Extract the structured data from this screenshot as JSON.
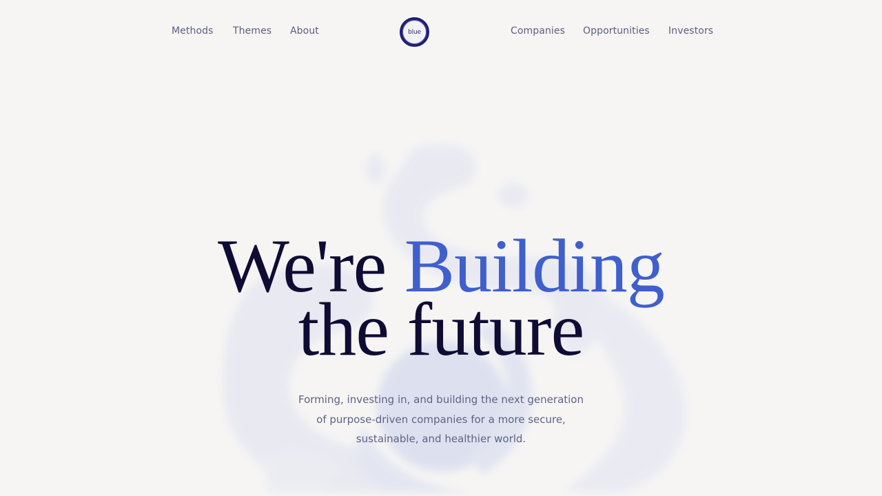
{
  "nav": {
    "left_links": [
      "Methods",
      "Themes",
      "About"
    ],
    "right_links": [
      "Companies",
      "Opportunities",
      "Investors"
    ],
    "logo_text": "blue"
  },
  "hero": {
    "headline_part1": "We're ",
    "headline_accent": "Building",
    "headline_line2": "the future",
    "subtitle_lines": [
      "Forming, investing in, and building the next generation",
      "of purpose-driven companies for a more secure,",
      "sustainable, and healthier world."
    ]
  },
  "colors": {
    "background": "#f6f5f4",
    "headline": "#0f0c33",
    "accent": "#3f5fcc",
    "nav_text": "#5a5e83"
  }
}
